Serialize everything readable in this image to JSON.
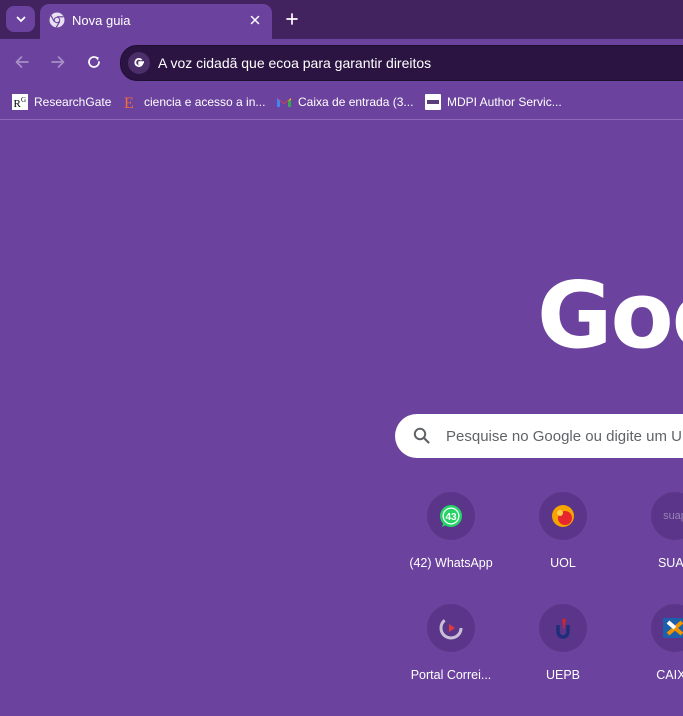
{
  "tabs": [
    {
      "title": "Nova guia",
      "icon": "chrome-icon",
      "active": true
    }
  ],
  "toolbar": {
    "omnibox_text": "A voz cidadã que ecoa para garantir direitos"
  },
  "bookmarks": [
    {
      "label": "ResearchGate",
      "icon": "researchgate-icon"
    },
    {
      "label": "ciencia e acesso a in...",
      "icon": "e-letter-icon"
    },
    {
      "label": "Caixa de entrada (3...",
      "icon": "gmail-icon"
    },
    {
      "label": "MDPI Author Servic...",
      "icon": "mdpi-icon"
    }
  ],
  "logo": {
    "text": "Google"
  },
  "search": {
    "placeholder": "Pesquise no Google ou digite um URL"
  },
  "shortcuts": [
    {
      "label": "(42) WhatsApp",
      "icon": "whatsapp-icon",
      "badge": "43"
    },
    {
      "label": "UOL",
      "icon": "uol-icon"
    },
    {
      "label": "SUAP",
      "icon": "suap-icon",
      "icon_text": "suap"
    },
    {
      "label": "Portal Correi...",
      "icon": "portal-icon"
    },
    {
      "label": "UEPB",
      "icon": "uepb-icon"
    },
    {
      "label": "CAIXA",
      "icon": "caixa-icon"
    }
  ],
  "colors": {
    "background": "#6b429d",
    "tabstrip": "#42235f",
    "omnibox": "#2b1442"
  }
}
